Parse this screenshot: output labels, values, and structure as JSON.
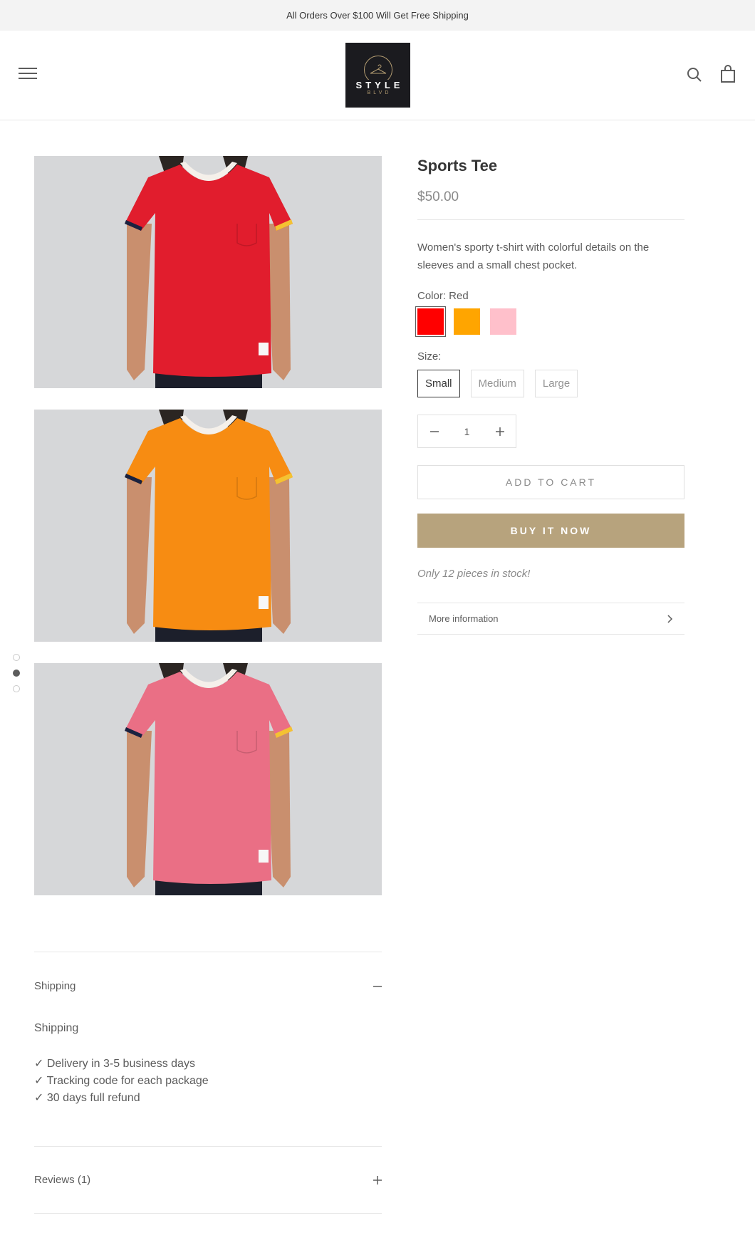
{
  "announcement": {
    "text": "All Orders Over $100 Will Get Free Shipping"
  },
  "header": {
    "logo_main": "STYLE",
    "logo_sub": "BLVD",
    "icons": {
      "menu": "menu-icon",
      "search": "search-icon",
      "cart": "shopping-bag-icon"
    }
  },
  "images": [
    {
      "color_name": "Red",
      "shirt_color": "#e11d2d",
      "bg": "#d6d7d9"
    },
    {
      "color_name": "Orange",
      "shirt_color": "#f78c12",
      "bg": "#d6d7d9"
    },
    {
      "color_name": "Pink",
      "shirt_color": "#ea6f85",
      "bg": "#d6d7d9"
    }
  ],
  "gallery_dots": {
    "count": 3,
    "active_index": 1
  },
  "product": {
    "title": "Sports Tee",
    "price": "$50.00",
    "description": "Women's sporty t-shirt with colorful details on the sleeves and a small chest pocket.",
    "color_label": "Color: Red",
    "colors": [
      {
        "name": "Red",
        "hex": "#ff0000",
        "selected": true
      },
      {
        "name": "Orange",
        "hex": "#ffa500",
        "selected": false
      },
      {
        "name": "Pink",
        "hex": "#ffc0cb",
        "selected": false
      }
    ],
    "size_label": "Size:",
    "sizes": [
      {
        "label": "Small",
        "selected": true
      },
      {
        "label": "Medium",
        "selected": false
      },
      {
        "label": "Large",
        "selected": false
      }
    ],
    "quantity": "1",
    "add_to_cart": "ADD TO CART",
    "buy_now": "BUY IT NOW",
    "stock_text": "Only 12 pieces in stock!",
    "more_info": "More information"
  },
  "accordion": {
    "shipping_title": "Shipping",
    "shipping_heading": "Shipping",
    "shipping_lines": [
      "✓ Delivery in 3-5 business days",
      "✓ Tracking code for each package",
      "✓ 30 days full refund"
    ],
    "reviews_title": "Reviews (1)",
    "accent": "#b7a37d"
  }
}
